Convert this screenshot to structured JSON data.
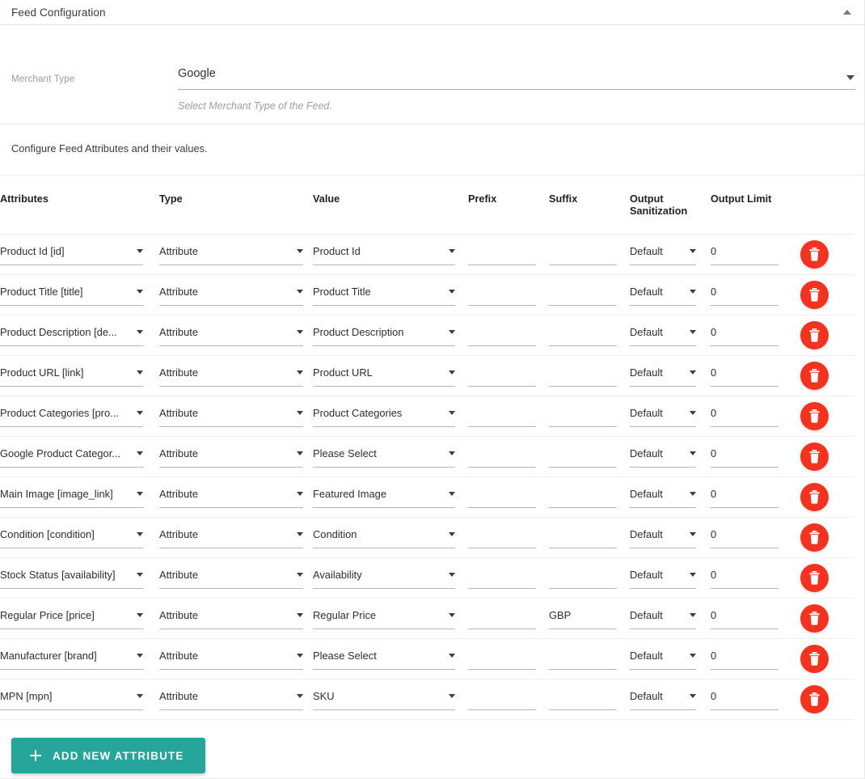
{
  "panel": {
    "title": "Feed Configuration",
    "collapse_icon": "caret-up-icon"
  },
  "merchant": {
    "label": "Merchant Type",
    "value": "Google",
    "help": "Select Merchant Type of the Feed.",
    "caret_icon": "chevron-down-icon"
  },
  "configure_note": "Configure Feed Attributes and their values.",
  "table": {
    "headers": {
      "attributes": "Attributes",
      "type": "Type",
      "value": "Value",
      "prefix": "Prefix",
      "suffix": "Suffix",
      "output_sanitization": "Output Sanitization",
      "output_limit": "Output Limit",
      "actions": ""
    },
    "rows": [
      {
        "attribute": "Product Id [id]",
        "type": "Attribute",
        "value": "Product Id",
        "prefix": "",
        "suffix": "",
        "sanitization": "Default",
        "limit": "0",
        "delete_icon": "trash-icon"
      },
      {
        "attribute": "Product Title [title]",
        "type": "Attribute",
        "value": "Product Title",
        "prefix": "",
        "suffix": "",
        "sanitization": "Default",
        "limit": "0",
        "delete_icon": "trash-icon"
      },
      {
        "attribute": "Product Description [de...",
        "type": "Attribute",
        "value": "Product Description",
        "prefix": "",
        "suffix": "",
        "sanitization": "Default",
        "limit": "0",
        "delete_icon": "trash-icon"
      },
      {
        "attribute": "Product URL [link]",
        "type": "Attribute",
        "value": "Product URL",
        "prefix": "",
        "suffix": "",
        "sanitization": "Default",
        "limit": "0",
        "delete_icon": "trash-icon"
      },
      {
        "attribute": "Product Categories [pro...",
        "type": "Attribute",
        "value": "Product Categories",
        "prefix": "",
        "suffix": "",
        "sanitization": "Default",
        "limit": "0",
        "delete_icon": "trash-icon"
      },
      {
        "attribute": "Google Product Categor...",
        "type": "Attribute",
        "value": "Please Select",
        "prefix": "",
        "suffix": "",
        "sanitization": "Default",
        "limit": "0",
        "delete_icon": "trash-icon"
      },
      {
        "attribute": "Main Image [image_link]",
        "type": "Attribute",
        "value": "Featured Image",
        "prefix": "",
        "suffix": "",
        "sanitization": "Default",
        "limit": "0",
        "delete_icon": "trash-icon"
      },
      {
        "attribute": "Condition [condition]",
        "type": "Attribute",
        "value": "Condition",
        "prefix": "",
        "suffix": "",
        "sanitization": "Default",
        "limit": "0",
        "delete_icon": "trash-icon"
      },
      {
        "attribute": "Stock Status [availability]",
        "type": "Attribute",
        "value": "Availability",
        "prefix": "",
        "suffix": "",
        "sanitization": "Default",
        "limit": "0",
        "delete_icon": "trash-icon"
      },
      {
        "attribute": "Regular Price [price]",
        "type": "Attribute",
        "value": "Regular Price",
        "prefix": "",
        "suffix": "GBP",
        "sanitization": "Default",
        "limit": "0",
        "delete_icon": "trash-icon"
      },
      {
        "attribute": "Manufacturer [brand]",
        "type": "Attribute",
        "value": "Please Select",
        "prefix": "",
        "suffix": "",
        "sanitization": "Default",
        "limit": "0",
        "delete_icon": "trash-icon"
      },
      {
        "attribute": "MPN [mpn]",
        "type": "Attribute",
        "value": "SKU",
        "prefix": "",
        "suffix": "",
        "sanitization": "Default",
        "limit": "0",
        "delete_icon": "trash-icon"
      }
    ]
  },
  "add_button": {
    "label": "ADD NEW ATTRIBUTE",
    "icon": "plus-icon"
  },
  "colors": {
    "accent_teal": "#26a69a",
    "delete_red": "#f3331f",
    "panel_border": "#e4e4e4",
    "text_primary": "#2e2e2e",
    "text_muted": "#9a9a9a"
  }
}
